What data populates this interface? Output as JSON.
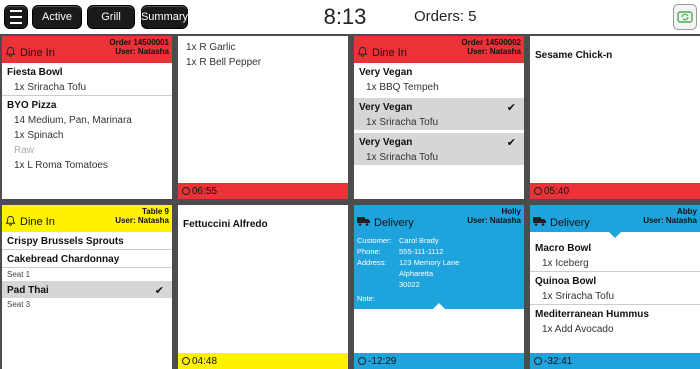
{
  "topbar": {
    "menu_icon": "hamburger-menu-icon",
    "tabs": [
      "Active",
      "Grill",
      "Summary"
    ],
    "clock": "8:13",
    "orders": "Orders: 5",
    "refresh_icon": "refresh-icon"
  },
  "colors": {
    "red": "#ed3237",
    "yellow": "#fff200",
    "blue": "#1fa3dc",
    "panel_bg": "#4c4c4c"
  },
  "cards": {
    "c1": {
      "title": "Dine In",
      "icon": "bell-icon",
      "order": "Order 14500001",
      "user": "User: Natasha",
      "items": [
        {
          "name": "Fiesta Bowl",
          "mods": [
            "1x Sriracha Tofu"
          ]
        },
        {
          "name": "BYO Pizza",
          "mods": [
            "14 Medium, Pan, Marinara",
            "1x Spinach",
            "Raw",
            "1x L Roma Tomatoes"
          ]
        }
      ]
    },
    "c2": {
      "mods": [
        "1x R Garlic",
        "1x R Bell Pepper"
      ],
      "timer": "06:55"
    },
    "c3": {
      "title": "Dine In",
      "icon": "bell-icon",
      "order": "Order 14500002",
      "user": "User: Natasha",
      "items": [
        {
          "name": "Very Vegan",
          "mods": [
            "1x BBQ Tempeh"
          ]
        },
        {
          "name": "Very Vegan",
          "mods": [
            "1x Sriracha Tofu"
          ]
        },
        {
          "name": "Very Vegan",
          "mods": [
            "1x Sriracha Tofu"
          ]
        }
      ]
    },
    "c4": {
      "item": "Sesame Chick-n",
      "timer": "05:40"
    },
    "c5": {
      "title": "Dine In",
      "icon": "bell-icon",
      "table": "Table 9",
      "user": "User: Natasha",
      "items": [
        "Crispy Brussels Sprouts",
        "Cakebread Chardonnay"
      ],
      "seat1": "Seat 1",
      "item3": "Pad Thai",
      "seat3": "Seat 3"
    },
    "c6": {
      "item": "Fettuccini Alfredo",
      "timer": "04:48"
    },
    "c7": {
      "title": "Delivery",
      "icon": "truck-icon",
      "name": "Holly",
      "user": "User: Natasha",
      "customer_label": "Customer:",
      "customer": "Carol Brady",
      "phone_label": "Phone:",
      "phone": "555-111-1112",
      "address_label": "Address:",
      "address1": "123 Memory Lane",
      "address2": "Alpharetta",
      "address3": "30022",
      "note_label": "Note:",
      "timer": "-12:29"
    },
    "c8": {
      "title": "Delivery",
      "icon": "truck-icon",
      "name": "Abby",
      "user": "User: Natasha",
      "items": [
        {
          "name": "Macro Bowl",
          "mods": [
            "1x Iceberg"
          ]
        },
        {
          "name": "Quinoa Bowl",
          "mods": [
            "1x Sriracha Tofu"
          ]
        },
        {
          "name": "Mediterranean Hummus",
          "mods": [
            "1x Add Avocado"
          ]
        }
      ],
      "timer": "-32:41"
    }
  }
}
